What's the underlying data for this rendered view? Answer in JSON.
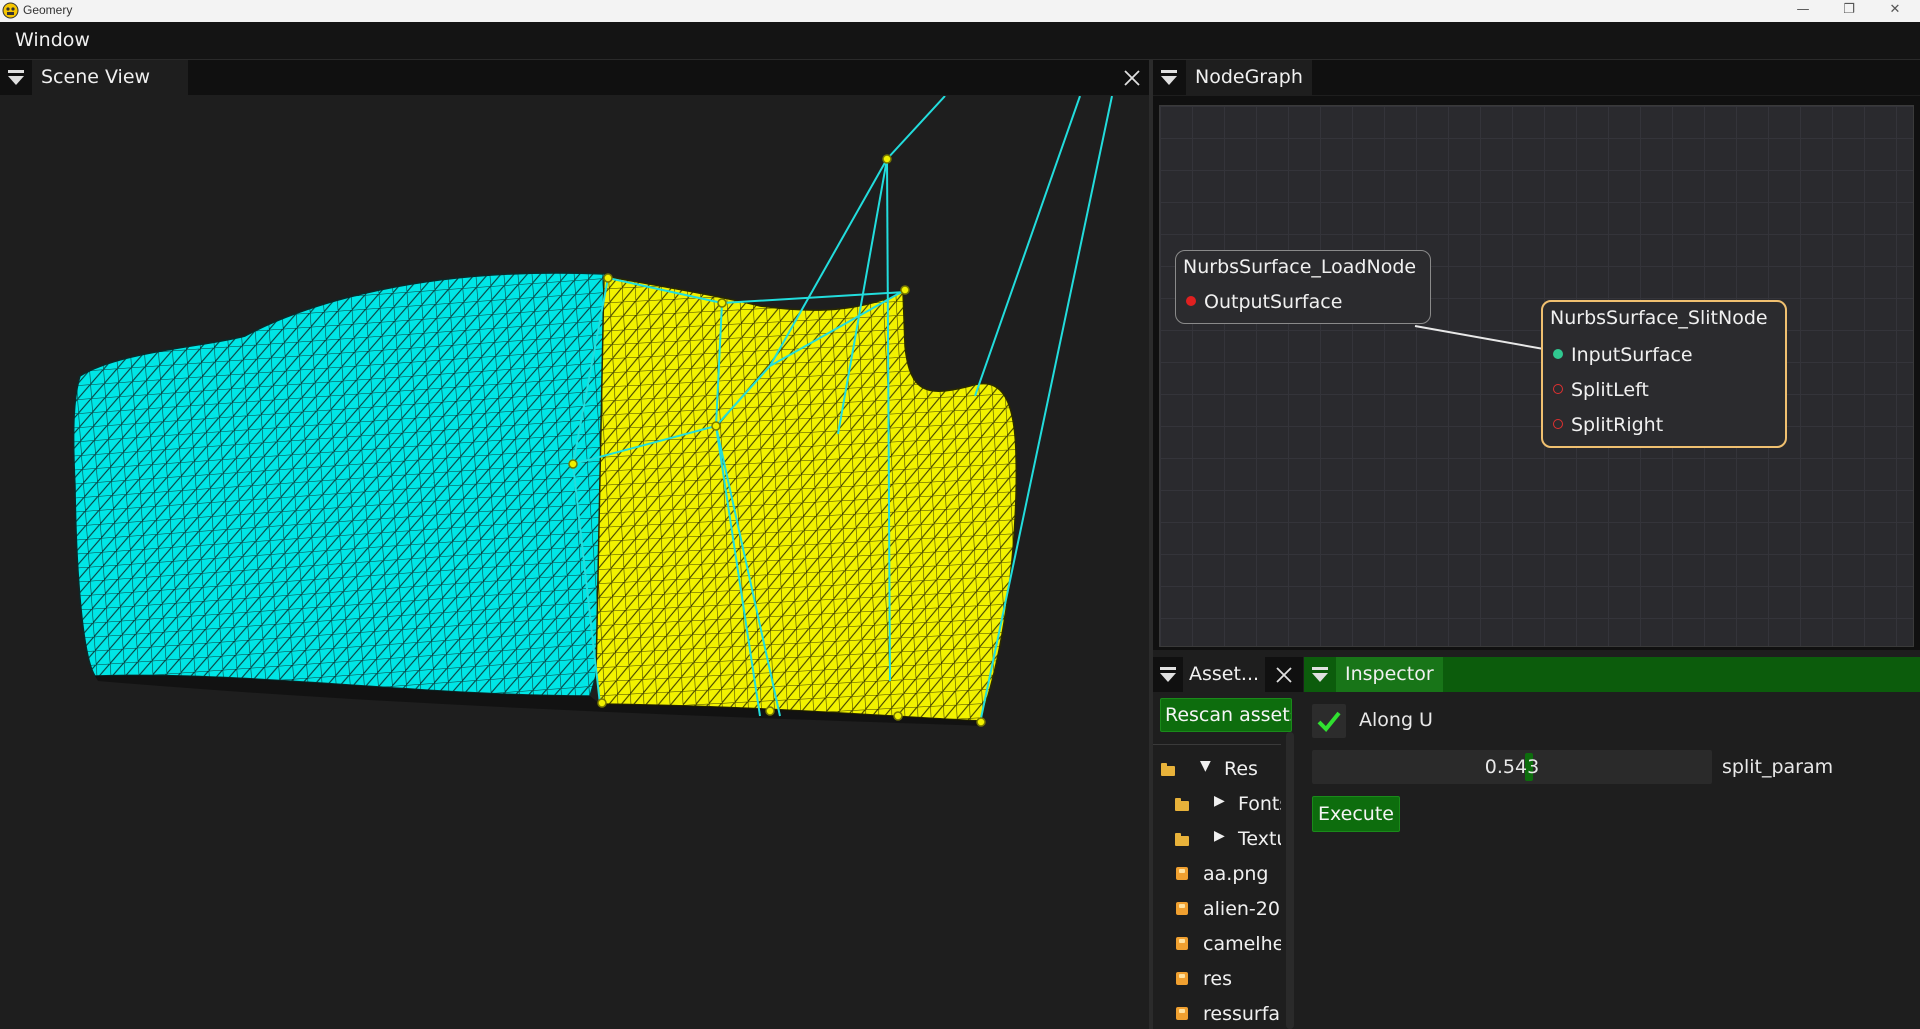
{
  "window": {
    "title": "Geomery",
    "minimize": "—",
    "restore": "❐",
    "close": "✕"
  },
  "menu": {
    "window": "Window"
  },
  "scene": {
    "tab": "Scene View",
    "close": "✕"
  },
  "nodegraph": {
    "tab": "NodeGraph",
    "load_node": {
      "title": "NurbsSurface_LoadNode",
      "output": "OutputSurface"
    },
    "split_node": {
      "title": "NurbsSurface_SlitNode",
      "input": "InputSurface",
      "left": "SplitLeft",
      "right": "SplitRight"
    }
  },
  "assets": {
    "tab": "Asset...",
    "rescan": "Rescan assets",
    "tree": [
      {
        "label": "Res",
        "kind": "folder",
        "expanded": true
      },
      {
        "label": "Fonts",
        "kind": "folder",
        "expanded": false
      },
      {
        "label": "Textures",
        "kind": "folder",
        "expanded": false
      },
      {
        "label": "aa.png",
        "kind": "file"
      },
      {
        "label": "alien-20",
        "kind": "file"
      },
      {
        "label": "camelhead",
        "kind": "file"
      },
      {
        "label": "res",
        "kind": "file"
      },
      {
        "label": "ressurface",
        "kind": "file"
      }
    ]
  },
  "inspector": {
    "tab": "Inspector",
    "along_u_label": "Along U",
    "along_u_checked": true,
    "split_param_value": "0.543",
    "split_param_fraction": 0.543,
    "split_param_label": "split_param",
    "execute": "Execute"
  },
  "colors": {
    "surface_left": "#00e8e8",
    "surface_right": "#f0f000",
    "control_net": "#22dddd",
    "accent_green": "#0c5c0c"
  }
}
